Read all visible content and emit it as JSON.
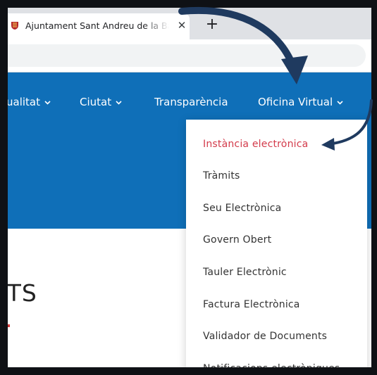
{
  "browser": {
    "tab_title": "Ajuntament Sant Andreu de la Ba",
    "tab_close": "✕",
    "new_tab": "+"
  },
  "nav": {
    "items": [
      {
        "label": "ualitat",
        "has_chevron": true
      },
      {
        "label": "Ciutat",
        "has_chevron": true
      },
      {
        "label": "Transparència",
        "has_chevron": false
      },
      {
        "label": "Oficina Virtual",
        "has_chevron": true
      }
    ]
  },
  "content": {
    "title": "ITS"
  },
  "dropdown": {
    "items": [
      {
        "label": "Instància electrònica",
        "active": true
      },
      {
        "label": "Tràmits"
      },
      {
        "label": "Seu Electrònica"
      },
      {
        "label": "Govern Obert"
      },
      {
        "label": "Tauler Electrònic"
      },
      {
        "label": "Factura Electrònica"
      },
      {
        "label": "Validador de Documents"
      },
      {
        "label": "Notificacions electròniques"
      }
    ]
  },
  "colors": {
    "header_blue": "#0f6fb8",
    "active_red": "#d33a4a",
    "annotation_arrow": "#1f3a5f"
  },
  "icons": {
    "favicon": "coat-of-arms-icon",
    "chevron": "chevron-down-icon",
    "annotation": "curved-arrow-icon"
  }
}
